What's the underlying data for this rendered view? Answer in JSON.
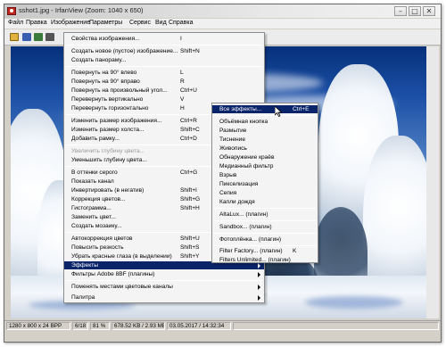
{
  "window": {
    "title": "sshot1.jpg - IrfanView (Zoom: 1040 x 650)"
  },
  "titlebar": {
    "minimize_label": "–",
    "maximize_label": "□",
    "close_label": "✕"
  },
  "menubar": {
    "items": [
      "Файл",
      "Правка",
      "Изображение",
      "Параметры",
      "Сервис",
      "Вид",
      "Справка"
    ]
  },
  "image_menu": {
    "items": [
      {
        "label": "Свойства изображения...",
        "shortcut": "I"
      },
      {
        "label": "Создать новое (пустое) изображение...",
        "shortcut": "Shift+N"
      },
      {
        "label": "Создать панораму...",
        "shortcut": ""
      },
      {
        "label": "Повернуть на 90° влево",
        "shortcut": "L"
      },
      {
        "label": "Повернуть на 90° вправо",
        "shortcut": "R"
      },
      {
        "label": "Повернуть на произвольный угол...",
        "shortcut": "Ctrl+U"
      },
      {
        "label": "Перевернуть вертикально",
        "shortcut": "V"
      },
      {
        "label": "Перевернуть горизонтально",
        "shortcut": "H"
      },
      {
        "label": "Изменить размер изображения...",
        "shortcut": "Ctrl+R"
      },
      {
        "label": "Изменить размер холста...",
        "shortcut": "Shift+C"
      },
      {
        "label": "Добавить рамку...",
        "shortcut": "Ctrl+D"
      },
      {
        "label": "Увеличить глубину цвета...",
        "shortcut": ""
      },
      {
        "label": "Уменьшить глубину цвета...",
        "shortcut": ""
      },
      {
        "label": "В оттенки серого",
        "shortcut": "Ctrl+G"
      },
      {
        "label": "Показать канал",
        "shortcut": ""
      },
      {
        "label": "Инвертировать (в негатив)",
        "shortcut": "Shift+I"
      },
      {
        "label": "Коррекция цветов...",
        "shortcut": "Shift+G"
      },
      {
        "label": "Гистограмма...",
        "shortcut": "Shift+H"
      },
      {
        "label": "Заменить цвет...",
        "shortcut": ""
      },
      {
        "label": "Создать мозаику...",
        "shortcut": ""
      },
      {
        "label": "Автокоррекция цветов",
        "shortcut": "Shift+U"
      },
      {
        "label": "Повысить резкость",
        "shortcut": "Shift+S"
      },
      {
        "label": "Убрать красные глаза (в выделении)",
        "shortcut": "Shift+Y"
      },
      {
        "label": "Эффекты",
        "shortcut": ""
      },
      {
        "label": "Фильтры Adobe 8BF (плагины)",
        "shortcut": ""
      },
      {
        "label": "Поменять местами цветовые каналы",
        "shortcut": ""
      },
      {
        "label": "Палитра",
        "shortcut": ""
      }
    ]
  },
  "effects_submenu": {
    "items": [
      {
        "label": "Все эффекты...",
        "shortcut": "Ctrl+E"
      },
      {
        "label": "Объёмная кнопка",
        "shortcut": ""
      },
      {
        "label": "Размытие",
        "shortcut": ""
      },
      {
        "label": "Тиснение",
        "shortcut": ""
      },
      {
        "label": "Живопись",
        "shortcut": ""
      },
      {
        "label": "Обнаружение краёв",
        "shortcut": ""
      },
      {
        "label": "Медианный фильтр",
        "shortcut": ""
      },
      {
        "label": "Взрыв",
        "shortcut": ""
      },
      {
        "label": "Пикселизация",
        "shortcut": ""
      },
      {
        "label": "Сепия",
        "shortcut": ""
      },
      {
        "label": "Капли дождя",
        "shortcut": ""
      },
      {
        "label": "AltaLux... (плагин)",
        "shortcut": ""
      },
      {
        "label": "Sandbox... (плагин)",
        "shortcut": ""
      },
      {
        "label": "Фотоплёнка... (плагин)",
        "shortcut": ""
      },
      {
        "label": "Filter Factory... (плагин)",
        "shortcut": "K"
      },
      {
        "label": "Filters Unlimited... (плагин)",
        "shortcut": ""
      }
    ]
  },
  "statusbar": {
    "dimensions": "1280 x 800 x 24 BPP",
    "index": "6/18",
    "zoom": "81 %",
    "size": "678.52 KB / 2.93 MB",
    "datetime": "03.05.2017 / 14:32:34"
  },
  "colors": {
    "menu_highlight": "#0a246a",
    "menu_bg": "#f4f4f4",
    "chrome": "#d4d0c8"
  }
}
